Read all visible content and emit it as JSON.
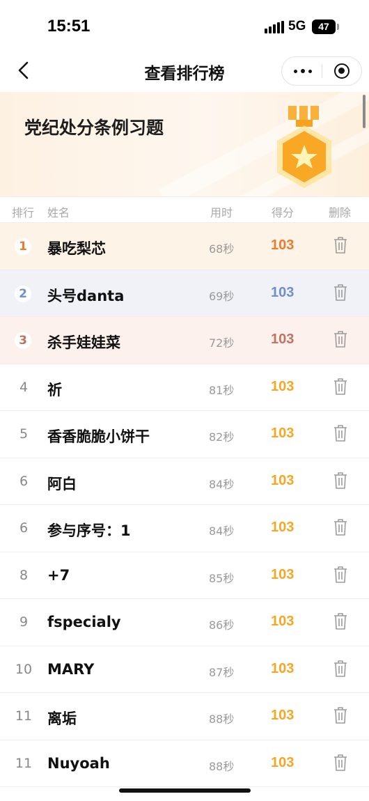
{
  "status": {
    "time": "15:51",
    "network": "5G",
    "battery": "47"
  },
  "nav": {
    "title": "查看排行榜"
  },
  "banner": {
    "title": "党纪处分条例习题"
  },
  "table": {
    "headers": {
      "rank": "排行",
      "name": "姓名",
      "time": "用时",
      "score": "得分",
      "delete": "删除"
    },
    "rows": [
      {
        "rank": "1",
        "name": "暴吃梨芯",
        "time": "68秒",
        "score": "103"
      },
      {
        "rank": "2",
        "name": "头号danta",
        "time": "69秒",
        "score": "103"
      },
      {
        "rank": "3",
        "name": "杀手娃娃菜",
        "time": "72秒",
        "score": "103"
      },
      {
        "rank": "4",
        "name": "祈",
        "time": "81秒",
        "score": "103"
      },
      {
        "rank": "5",
        "name": "香香脆脆小饼干",
        "time": "82秒",
        "score": "103"
      },
      {
        "rank": "6",
        "name": "阿白",
        "time": "84秒",
        "score": "103"
      },
      {
        "rank": "6",
        "name": "参与序号：1",
        "time": "84秒",
        "score": "103"
      },
      {
        "rank": "8",
        "name": "+7",
        "time": "85秒",
        "score": "103"
      },
      {
        "rank": "9",
        "name": "fspecialy",
        "time": "86秒",
        "score": "103"
      },
      {
        "rank": "10",
        "name": "MARY",
        "time": "87秒",
        "score": "103"
      },
      {
        "rank": "11",
        "name": "离垢",
        "time": "88秒",
        "score": "103"
      },
      {
        "rank": "11",
        "name": "Nuyoah",
        "time": "88秒",
        "score": "103"
      }
    ]
  },
  "colors": {
    "gold_row_bg": "#fdf3e6",
    "silver_row_bg": "#f1f2f8",
    "bronze_row_bg": "#fdf1ee",
    "gold": "#ec7a2f",
    "silver": "#6f8fcf",
    "bronze": "#c2735f",
    "score_default": "#f5a623"
  },
  "icons": {
    "back": "chevron-left-icon",
    "more": "more-dots-icon",
    "close": "target-close-icon",
    "medal": "medal-icon",
    "delete": "trash-icon"
  }
}
